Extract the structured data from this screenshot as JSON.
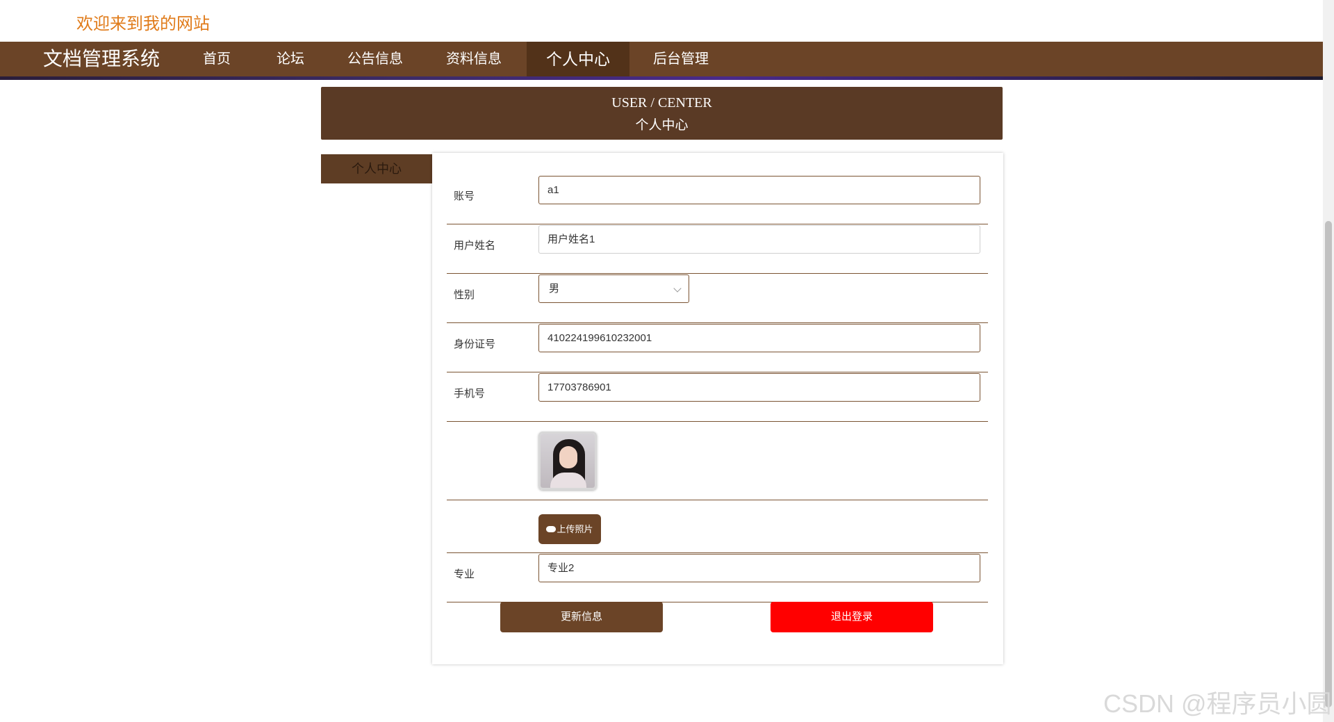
{
  "header": {
    "welcome_text": "欢迎来到我的网站"
  },
  "nav": {
    "brand": "文档管理系统",
    "items": [
      {
        "label": "首页"
      },
      {
        "label": "论坛"
      },
      {
        "label": "公告信息"
      },
      {
        "label": "资料信息"
      },
      {
        "label": "个人中心",
        "active": true
      },
      {
        "label": "后台管理"
      }
    ]
  },
  "banner": {
    "title_en": "USER / CENTER",
    "title_cn": "个人中心"
  },
  "side_menu": {
    "item_label": "个人中心"
  },
  "form": {
    "account": {
      "label": "账号",
      "value": "a1"
    },
    "user_name": {
      "label": "用户姓名",
      "value": "用户姓名1"
    },
    "gender": {
      "label": "性别",
      "value": "男"
    },
    "id_number": {
      "label": "身份证号",
      "value": "410224199610232001"
    },
    "phone": {
      "label": "手机号",
      "value": "17703786901"
    },
    "upload_label": "上传照片",
    "major": {
      "label": "专业",
      "value": "专业2"
    },
    "update_button": "更新信息",
    "logout_button": "退出登录"
  },
  "colors": {
    "brand_brown": "#6b4427",
    "banner_brown": "#5a3a25",
    "logout_red": "#ff0000",
    "welcome_orange": "#e07b1a"
  },
  "watermark": "CSDN @程序员小圆"
}
